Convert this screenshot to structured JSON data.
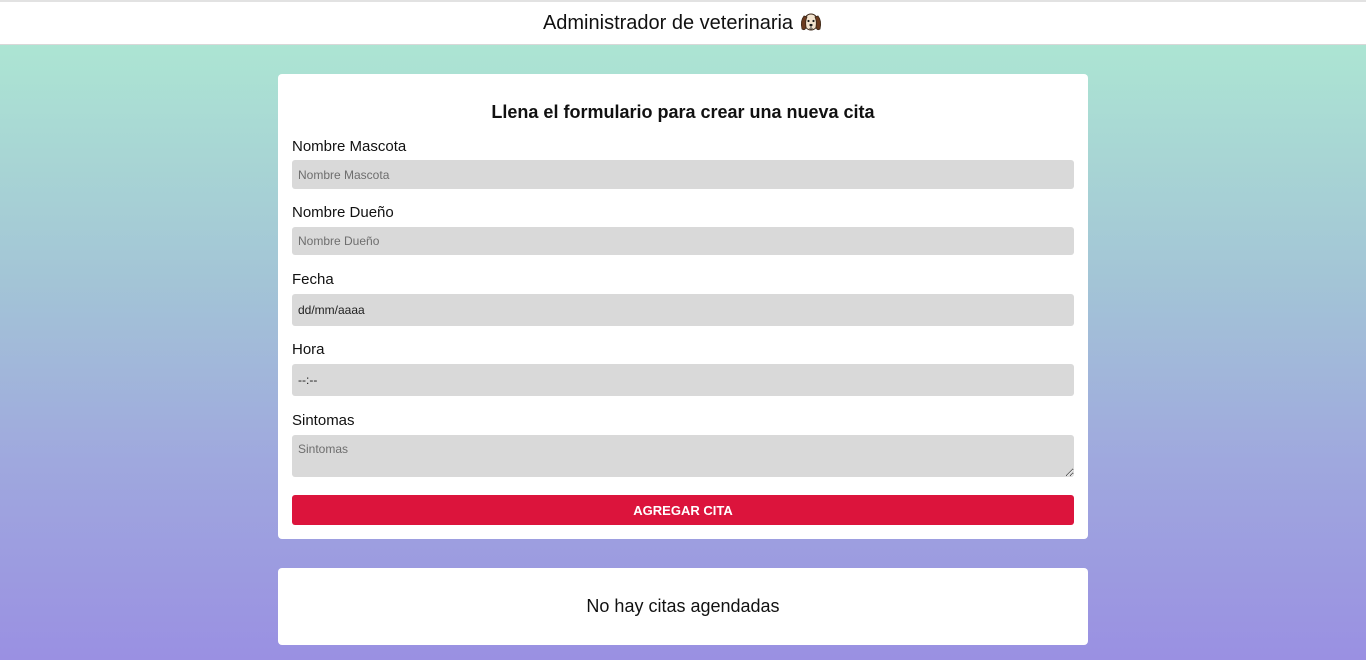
{
  "header": {
    "title": "Administrador de veterinaria",
    "icon": "dog-icon"
  },
  "form": {
    "title": "Llena el formulario para crear una nueva cita",
    "pet_name": {
      "label": "Nombre Mascota",
      "placeholder": "Nombre Mascota",
      "value": ""
    },
    "owner_name": {
      "label": "Nombre Dueño",
      "placeholder": "Nombre Dueño",
      "value": ""
    },
    "date": {
      "label": "Fecha",
      "value": "dd/mm/aaaa"
    },
    "time": {
      "label": "Hora",
      "value": "--:--"
    },
    "symptoms": {
      "label": "Sintomas",
      "placeholder": "Sintomas",
      "value": ""
    },
    "submit_label": "AGREGAR CITA"
  },
  "appointments": {
    "empty_message": "No hay citas agendadas"
  },
  "colors": {
    "accent": "#dc143c",
    "input_bg": "#d9d9d9"
  }
}
